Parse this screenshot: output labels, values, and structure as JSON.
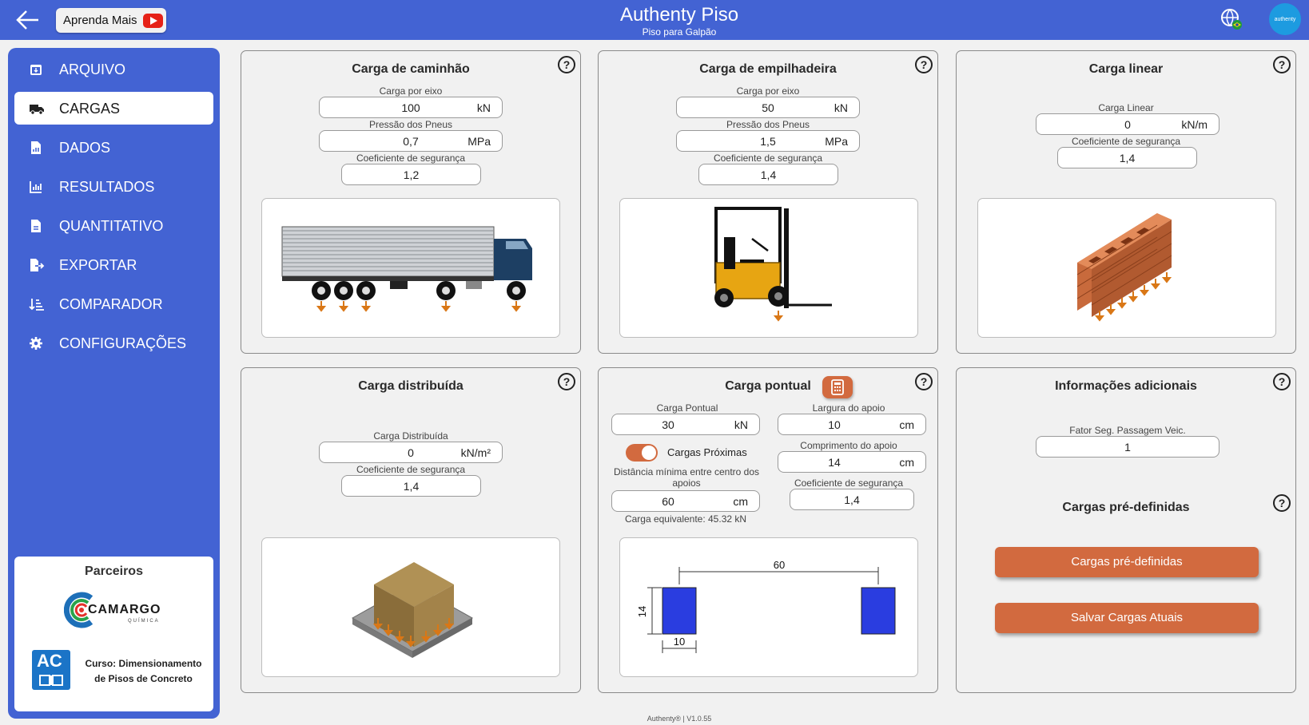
{
  "header": {
    "title": "Authenty Piso",
    "subtitle": "Piso para Galpão",
    "learn_more": "Aprenda Mais",
    "avatar_text": "authenty"
  },
  "sidebar": {
    "items": [
      {
        "label": "ARQUIVO",
        "icon": "archive-icon"
      },
      {
        "label": "CARGAS",
        "icon": "truck-icon",
        "active": true
      },
      {
        "label": "DADOS",
        "icon": "document-chart-icon"
      },
      {
        "label": "RESULTADOS",
        "icon": "bar-chart-icon"
      },
      {
        "label": "QUANTITATIVO",
        "icon": "document-icon"
      },
      {
        "label": "EXPORTAR",
        "icon": "export-icon"
      },
      {
        "label": "COMPARADOR",
        "icon": "sort-icon"
      },
      {
        "label": "CONFIGURAÇÕES",
        "icon": "gear-icon"
      }
    ],
    "partners": {
      "title": "Parceiros",
      "camargo": "CAMARGO",
      "camargo_sub": "QUÍMICA",
      "course_badge": "AC",
      "course_line1_bold": "Curso:",
      "course_line1": " Dimensionamento",
      "course_line2": "de Pisos de Concreto"
    }
  },
  "truck": {
    "title": "Carga de caminhão",
    "axle_label": "Carga por eixo",
    "axle_value": "100",
    "axle_unit": "kN",
    "tire_label": "Pressão dos Pneus",
    "tire_value": "0,7",
    "tire_unit": "MPa",
    "safety_label": "Coeficiente de segurança",
    "safety_value": "1,2"
  },
  "forklift": {
    "title": "Carga de empilhadeira",
    "axle_label": "Carga por eixo",
    "axle_value": "50",
    "axle_unit": "kN",
    "tire_label": "Pressão dos Pneus",
    "tire_value": "1,5",
    "tire_unit": "MPa",
    "safety_label": "Coeficiente de segurança",
    "safety_value": "1,4"
  },
  "linear": {
    "title": "Carga linear",
    "load_label": "Carga Linear",
    "load_value": "0",
    "load_unit": "kN/m",
    "safety_label": "Coeficiente de segurança",
    "safety_value": "1,4"
  },
  "distributed": {
    "title": "Carga distribuída",
    "load_label": "Carga Distribuída",
    "load_value": "0",
    "load_unit": "kN/m²",
    "safety_label": "Coeficiente de segurança",
    "safety_value": "1,4"
  },
  "point": {
    "title": "Carga pontual",
    "load_label": "Carga Pontual",
    "load_value": "30",
    "load_unit": "kN",
    "width_label": "Largura do apoio",
    "width_value": "10",
    "width_unit": "cm",
    "length_label": "Comprimento do apoio",
    "length_value": "14",
    "length_unit": "cm",
    "nearby_label": "Cargas Próximas",
    "nearby_on": true,
    "distance_label_1": "Distância mínima entre centro dos",
    "distance_label_2": "apoios",
    "distance_value": "60",
    "distance_unit": "cm",
    "safety_label": "Coeficiente de segurança",
    "safety_value": "1,4",
    "equivalent": "Carga equivalente: 45.32 kN",
    "diagram": {
      "spacing": "60",
      "depth": "14",
      "width": "10"
    }
  },
  "additional": {
    "title": "Informações adicionais",
    "factor_label": "Fator Seg. Passagem Veic.",
    "factor_value": "1",
    "predefined_title": "Cargas pré-definidas",
    "predefined_button": "Cargas pré-definidas",
    "save_button": "Salvar Cargas Atuais"
  },
  "footer": {
    "version": "Authenty® | V1.0.55"
  },
  "colors": {
    "primary": "#4363d3",
    "accent": "#d26a3f",
    "load_arrow": "#d97716"
  }
}
